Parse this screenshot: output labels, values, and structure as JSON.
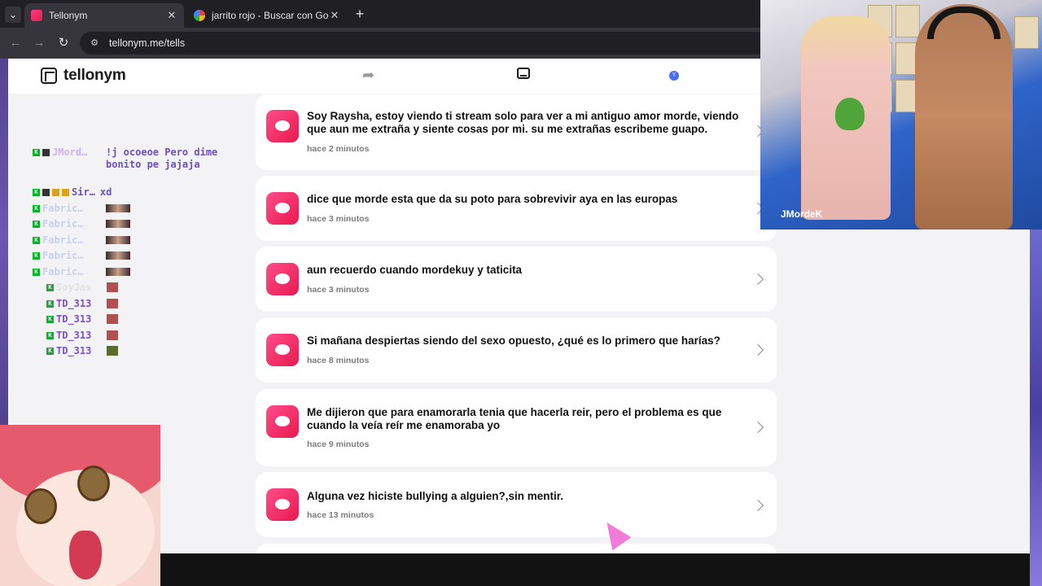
{
  "browser": {
    "tabs": [
      {
        "title": "Tellonym",
        "active": true
      },
      {
        "title": "jarrito rojo - Buscar con Google",
        "active": false
      }
    ],
    "new_tab_symbol": "+",
    "url": "tellonym.me/tells"
  },
  "app": {
    "name": "tellonym",
    "avatar_initial": "Y",
    "accent": "#e8194f"
  },
  "tells": [
    {
      "text": "Soy Raysha, estoy viendo ti stream solo para ver a mi antiguo amor morde, viendo que aun me extraña y siente cosas por mi. su me extrañas escribeme guapo.",
      "time": "hace 2 minutos"
    },
    {
      "text": "dice que morde esta que da su poto para sobrevivir aya en las europas",
      "time": "hace 3 minutos"
    },
    {
      "text": "aun recuerdo cuando mordekuy y taticita",
      "time": "hace 3 minutos"
    },
    {
      "text": "Si mañana despiertas siendo del sexo opuesto, ¿qué es lo primero que harías?",
      "time": "hace 8 minutos"
    },
    {
      "text": "Me dijieron que para enamorarla tenia que hacerla reir, pero el problema es que cuando la veía reír me enamoraba yo",
      "time": "hace 9 minutos"
    },
    {
      "text": "Alguna vez hiciste bullying a alguien?,sin mentir.",
      "time": "hace 13 minutos"
    }
  ],
  "chat": [
    {
      "name": "JMord…",
      "message": "!j ocoeoe Pero dime bonito pe jajaja",
      "name_color": "#c9b3f0"
    },
    {
      "name": "Sir…",
      "message": "xd",
      "name_color": "#6b4ec9"
    },
    {
      "name": "Fabric…",
      "message": "",
      "name_color": "#c9cff0"
    },
    {
      "name": "Fabric…",
      "message": "",
      "name_color": "#c9cff0"
    },
    {
      "name": "Fabric…",
      "message": "",
      "name_color": "#c9cff0"
    },
    {
      "name": "Fabric…",
      "message": "",
      "name_color": "#c9cff0"
    },
    {
      "name": "Fabric…",
      "message": "",
      "name_color": "#c9cff0"
    },
    {
      "name": "SoyJas",
      "message": "",
      "name_color": "#e2e2e2"
    },
    {
      "name": "TD_313",
      "message": "",
      "name_color": "#7b4fd6"
    },
    {
      "name": "TD_313",
      "message": "",
      "name_color": "#7b4fd6"
    },
    {
      "name": "TD_313",
      "message": "",
      "name_color": "#7b4fd6"
    },
    {
      "name": "TD_313",
      "message": "",
      "name_color": "#7b4fd6"
    }
  ],
  "webcam": {
    "overlay_name": "JMordeK"
  }
}
